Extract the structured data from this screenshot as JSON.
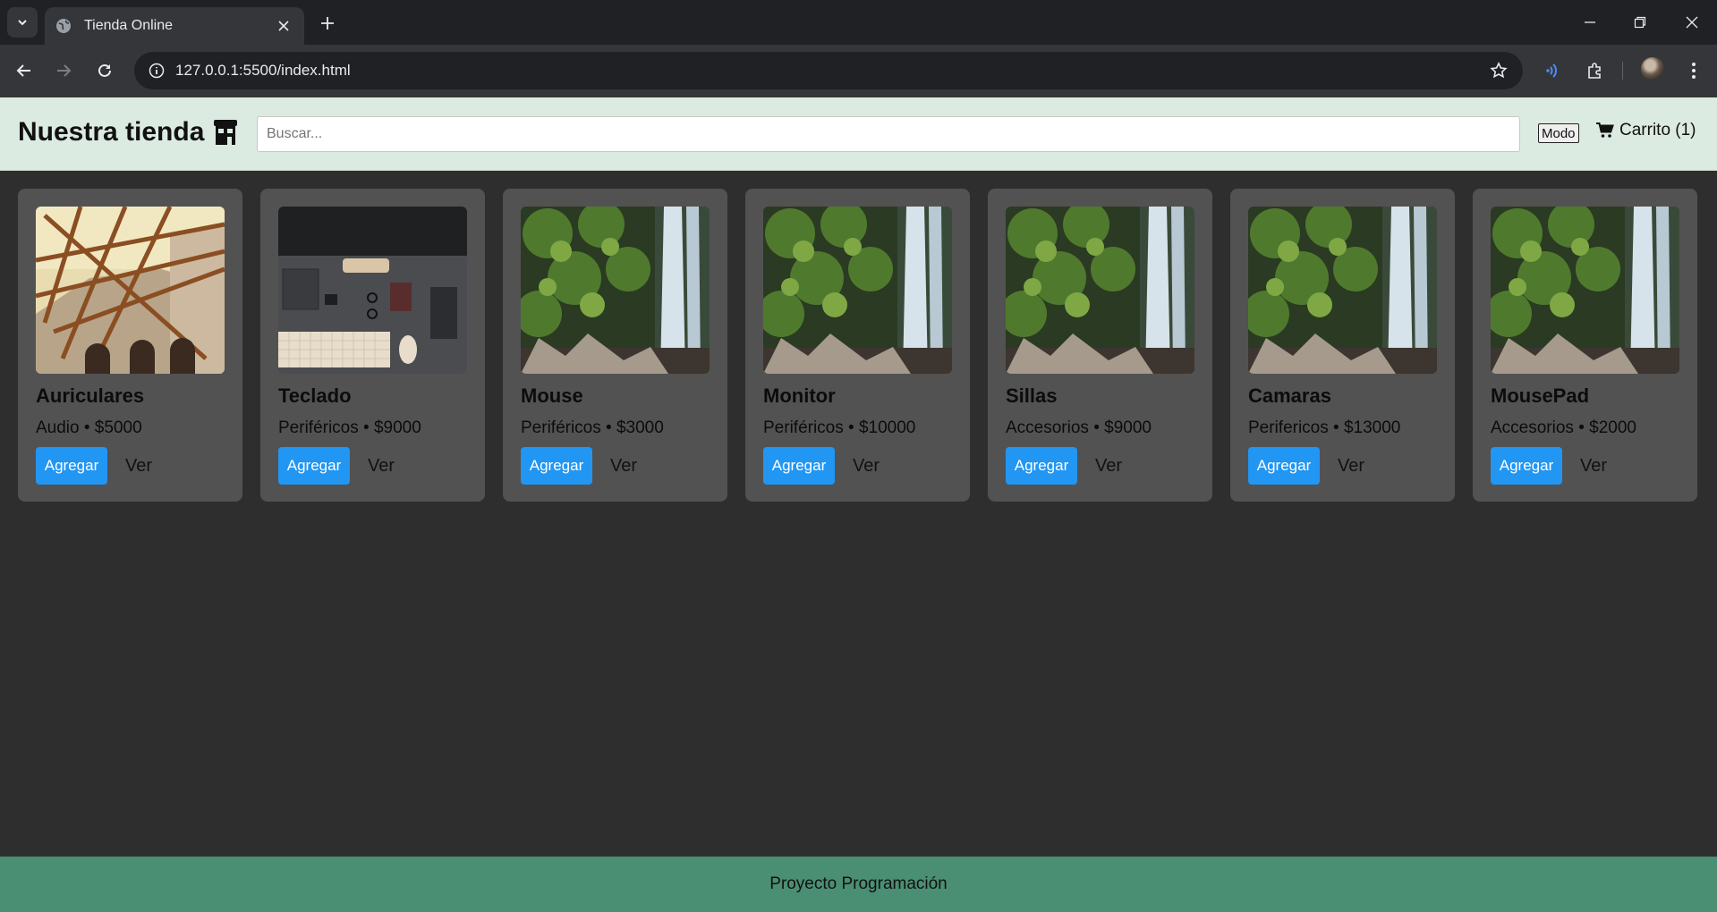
{
  "browser": {
    "tab_title": "Tienda Online",
    "url": "127.0.0.1:5500/index.html"
  },
  "header": {
    "title": "Nuestra tienda",
    "search_placeholder": "Buscar...",
    "mode_label": "Modo",
    "cart_label": "Carrito (1)"
  },
  "products": [
    {
      "name": "Auriculares",
      "meta": "Audio • $5000",
      "image": "architecture"
    },
    {
      "name": "Teclado",
      "meta": "Periféricos • $9000",
      "image": "desk-keyboard"
    },
    {
      "name": "Mouse",
      "meta": "Periféricos • $3000",
      "image": "waterfall"
    },
    {
      "name": "Monitor",
      "meta": "Periféricos • $10000",
      "image": "waterfall"
    },
    {
      "name": "Sillas",
      "meta": "Accesorios • $9000",
      "image": "waterfall"
    },
    {
      "name": "Camaras",
      "meta": "Perifericos • $13000",
      "image": "waterfall"
    },
    {
      "name": "MousePad",
      "meta": "Accesorios • $2000",
      "image": "waterfall"
    }
  ],
  "buttons": {
    "add_label": "Agregar",
    "view_label": "Ver"
  },
  "footer": {
    "text": "Proyecto Programación"
  },
  "colors": {
    "accent": "#2196f3",
    "header_bg": "#dcebe1",
    "footer_bg": "#4a8f74",
    "card_bg": "#525252",
    "page_bg": "#2e2e2e"
  }
}
